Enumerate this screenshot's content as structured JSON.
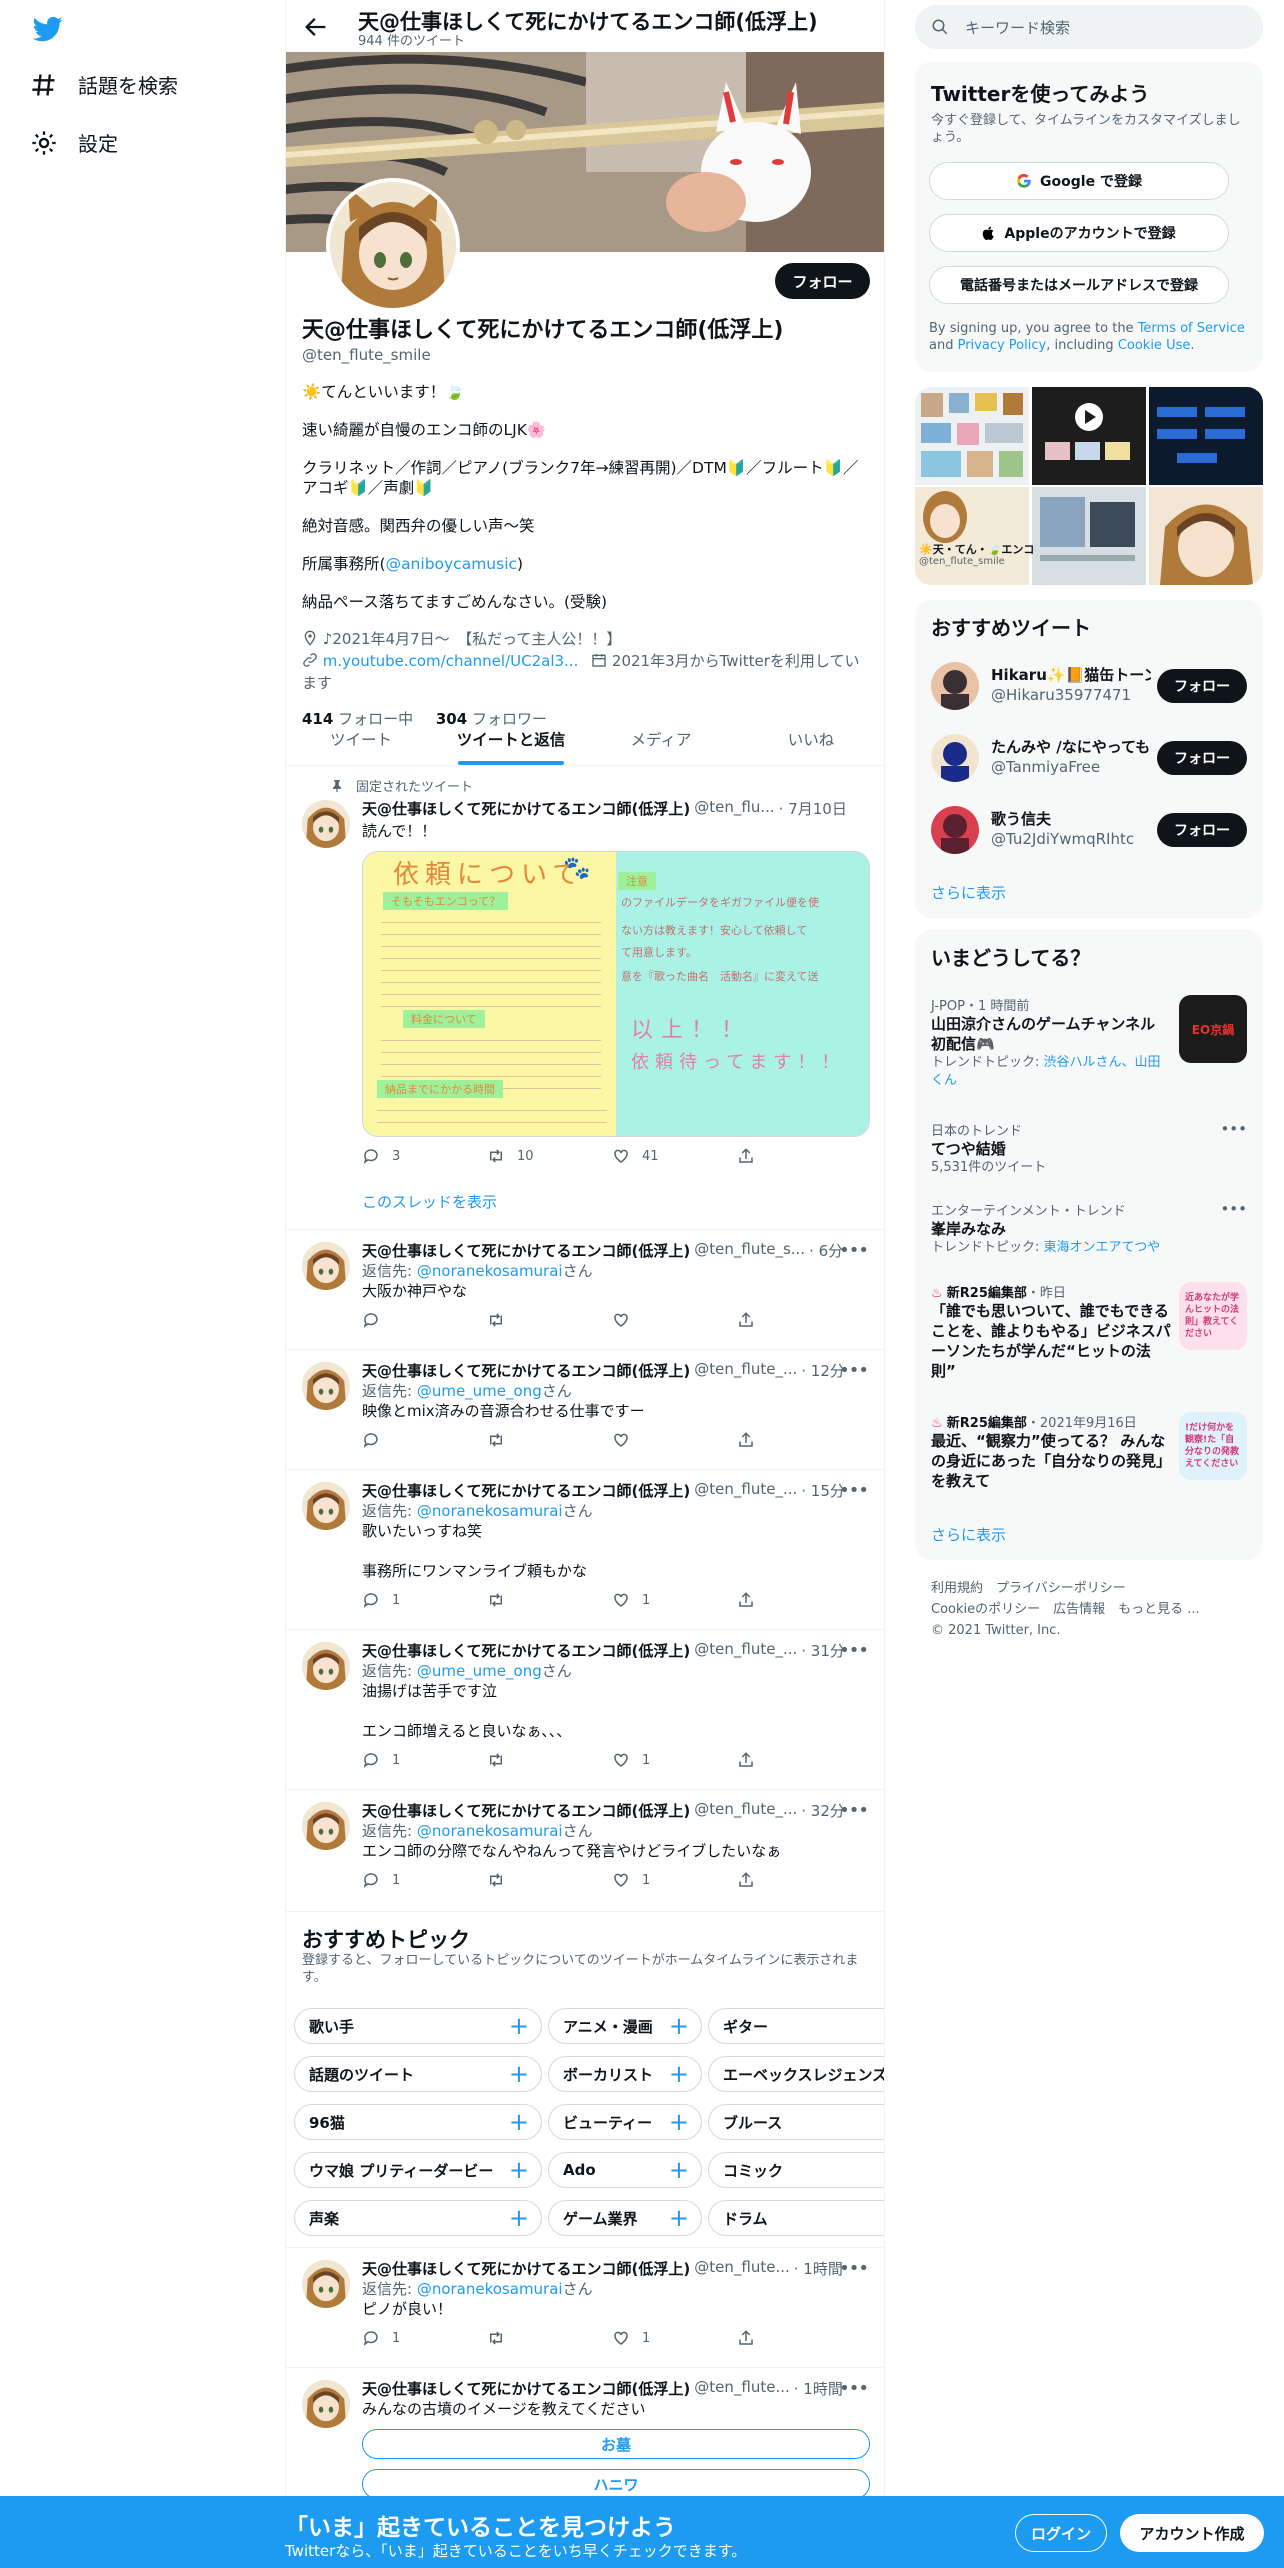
{
  "nav": {
    "explore": "話題を検索",
    "settings": "設定"
  },
  "header": {
    "name": "天@仕事ほしくて死にかけてるエンコ師(低浮上)",
    "tweet_count": "944 件のツイート"
  },
  "profile": {
    "follow": "フォロー",
    "name": "天@仕事ほしくて死にかけてるエンコ師(低浮上)",
    "handle": "@ten_flute_smile",
    "bio1": "☀️てんといいます！🍃",
    "bio2": "速い綺麗が自慢のエンコ師のLJK🌸",
    "bio3": "クラリネット／作詞／ピアノ(ブランク7年→練習再開)／DTM🔰／フルート🔰／アコギ🔰／声劇🔰",
    "bio4": "絶対音感。関西弁の優しい声〜笑",
    "bio5_pre": "所属事務所(",
    "bio5_link": "@aniboycamusic",
    "bio5_post": ")",
    "bio6": "納品ペース落ちてますごめんなさい。(受験)",
    "location": "♪2021年4月7日〜　【私だって主人公！！】",
    "url": "m.youtube.com/channel/UC2al3...",
    "joined": "2021年3月からTwitterを利用しています",
    "following_n": "414",
    "following_l": " フォロー中",
    "followers_n": "304",
    "followers_l": " フォロワー"
  },
  "tabs": [
    "ツイート",
    "ツイートと返信",
    "メディア",
    "いいね"
  ],
  "pinned": {
    "label": "固定されたツイート",
    "name": "天@仕事ほしくて死にかけてるエンコ師(低浮上)",
    "handle": "@ten_flu...",
    "time": "· 7月10日",
    "text": "読んで！！",
    "img_title": "依頼について",
    "img_sub1": "そもそもエンコって？",
    "img_sub2": "料金について",
    "img_sub3": "納品までにかかる時間",
    "img_right1": "以上！！",
    "img_right2": "依頼待ってます！！",
    "img_right_top": "注意",
    "img_right_line": "のファイルデータをギガファイル便を使",
    "img_right_line2": "ない方は教えます！安心して依頼して",
    "img_right_line3": "て用意します。",
    "img_right_line4": "意を『歌った曲名　活動名』に変えて送",
    "replies": "3",
    "retweets": "10",
    "likes": "41",
    "thread": "このスレッドを表示"
  },
  "tweets": [
    {
      "name": "天@仕事ほしくて死にかけてるエンコ師(低浮上)",
      "handle": "@ten_flute_s...",
      "time": "· 6分",
      "reply_to": "@noranekosamurai",
      "text1": "大阪か神戸やな",
      "text2": "",
      "replies": "",
      "likes": ""
    },
    {
      "name": "天@仕事ほしくて死にかけてるエンコ師(低浮上)",
      "handle": "@ten_flute_...",
      "time": "· 12分",
      "reply_to": "@ume_ume_ong",
      "text1": "映像とmix済みの音源合わせる仕事ですー",
      "text2": "",
      "replies": "",
      "likes": ""
    },
    {
      "name": "天@仕事ほしくて死にかけてるエンコ師(低浮上)",
      "handle": "@ten_flute_...",
      "time": "· 15分",
      "reply_to": "@noranekosamurai",
      "text1": "歌いたいっすね笑",
      "text2": "事務所にワンマンライブ頼もかな",
      "replies": "1",
      "likes": "1"
    },
    {
      "name": "天@仕事ほしくて死にかけてるエンコ師(低浮上)",
      "handle": "@ten_flute_...",
      "time": "· 31分",
      "reply_to": "@ume_ume_ong",
      "text1": "油揚げは苦手です泣",
      "text2": "エンコ師増えると良いなぁ、、、",
      "replies": "1",
      "likes": "1"
    },
    {
      "name": "天@仕事ほしくて死にかけてるエンコ師(低浮上)",
      "handle": "@ten_flute_...",
      "time": "· 32分",
      "reply_to": "@noranekosamurai",
      "text1": "エンコ師の分際でなんやねんって発言やけどライブしたいなぁ",
      "text2": "",
      "replies": "1",
      "likes": "1"
    }
  ],
  "reply_prefix": "返信先: ",
  "reply_suffix": "さん",
  "topics": {
    "title": "おすすめトピック",
    "desc": "登録すると、フォローしているトピックについてのツイートがホームタイムラインに表示されます。",
    "items": [
      "歌い手",
      "アニメ・漫画",
      "ギター",
      "話題のツイート",
      "ボーカリスト",
      "エーベックスレジェンズ",
      "96猫",
      "ビューティー",
      "ブルース",
      "ウマ娘 プリティーダービー",
      "Ado",
      "コミック",
      "声楽",
      "ゲーム業界",
      "ドラム"
    ]
  },
  "tweets2": [
    {
      "name": "天@仕事ほしくて死にかけてるエンコ師(低浮上)",
      "handle": "@ten_flute...",
      "time": "· 1時間",
      "reply_to": "@noranekosamurai",
      "text1": "ピノが良い！",
      "replies": "1",
      "likes": "1"
    },
    {
      "name": "天@仕事ほしくて死にかけてるエンコ師(低浮上)",
      "handle": "@ten_flute...",
      "time": "· 1時間",
      "text1": "みんなの古墳のイメージを教えてください",
      "poll1": "お墓",
      "poll2": "ハニワ"
    }
  ],
  "right": {
    "search_placeholder": "キーワード検索",
    "join_title": "Twitterを使ってみよう",
    "join_sub": "今すぐ登録して、タイムラインをカスタマイズしましょう。",
    "google": "Google で登録",
    "apple": "Appleのアカウントで登録",
    "phone": "電話番号またはメールアドレスで登録",
    "terms_pre": "By signing up, you agree to the ",
    "terms": "Terms of Service",
    "terms_and": " and ",
    "privacy": "Privacy Policy",
    "terms_inc": ", including ",
    "cookie": "Cookie Use",
    "terms_end": ".",
    "grid_caption_name": "☀️天・てん・🍃エンコ",
    "grid_caption_handle": "@ten_flute_smile",
    "rec_title": "おすすめツイート",
    "recs": [
      {
        "name": "Hikaru✨📙猫缶トーン",
        "handle": "@Hikaru35977471",
        "btn": "フォロー"
      },
      {
        "name": "たんみや /なにやってもク",
        "handle": "@TanmiyaFree",
        "btn": "フォロー"
      },
      {
        "name": "歌う信夫",
        "handle": "@Tu2JdiYwmqRIhtc",
        "btn": "フォロー"
      }
    ],
    "more": "さらに表示",
    "trend_title": "いまどうしてる？",
    "trend1_cat": "J-POP・1 時間前",
    "trend1_t": "山田涼介さんのゲームチャンネル初配信🎮",
    "trend1_pre": "トレンドトピック: ",
    "trend1_s": "渋谷ハルさん、山田くん",
    "trend1_img": "EO京鍋",
    "trend2_cat": "日本のトレンド",
    "trend2_t": "てつや結婚",
    "trend2_s": "5,531件のツイート",
    "trend3_cat": "エンターテインメント・トレンド",
    "trend3_t": "峯岸みなみ",
    "trend3_pre": "トレンドトピック: ",
    "trend3_s": "東海オンエアてつや",
    "trend4_cat": "新R25編集部",
    "trend4_time": "・昨日",
    "trend4_t": "「誰でも思いついて、誰でもできることを、誰よりもやる」ビジネスパーソンたちが学んだ“ヒットの法則”",
    "trend4_img": "近あなたが学んヒットの法則」教えてください",
    "trend5_cat": "新R25編集部",
    "trend5_time": "・2021年9月16日",
    "trend5_t": "最近、“観察力”使ってる？ みんなの身近にあった「自分なりの発見」を教えて",
    "trend5_img": "!だけ何かを観察!た「自分なりの発教えてください",
    "more2": "さらに表示",
    "footer1": "利用規約　プライバシーポリシー",
    "footer2": "Cookieのポリシー　広告情報　もっと見る ...",
    "footer3": "© 2021 Twitter, Inc."
  },
  "bottom": {
    "title": "「いま」起きていることを見つけよう",
    "sub": "Twitterなら、「いま」起きていることをいち早くチェックできます。",
    "login": "ログイン",
    "signup": "アカウント作成"
  },
  "colors": {
    "accent": "#1d9bf0",
    "text": "#0f1419",
    "muted": "#536471"
  }
}
